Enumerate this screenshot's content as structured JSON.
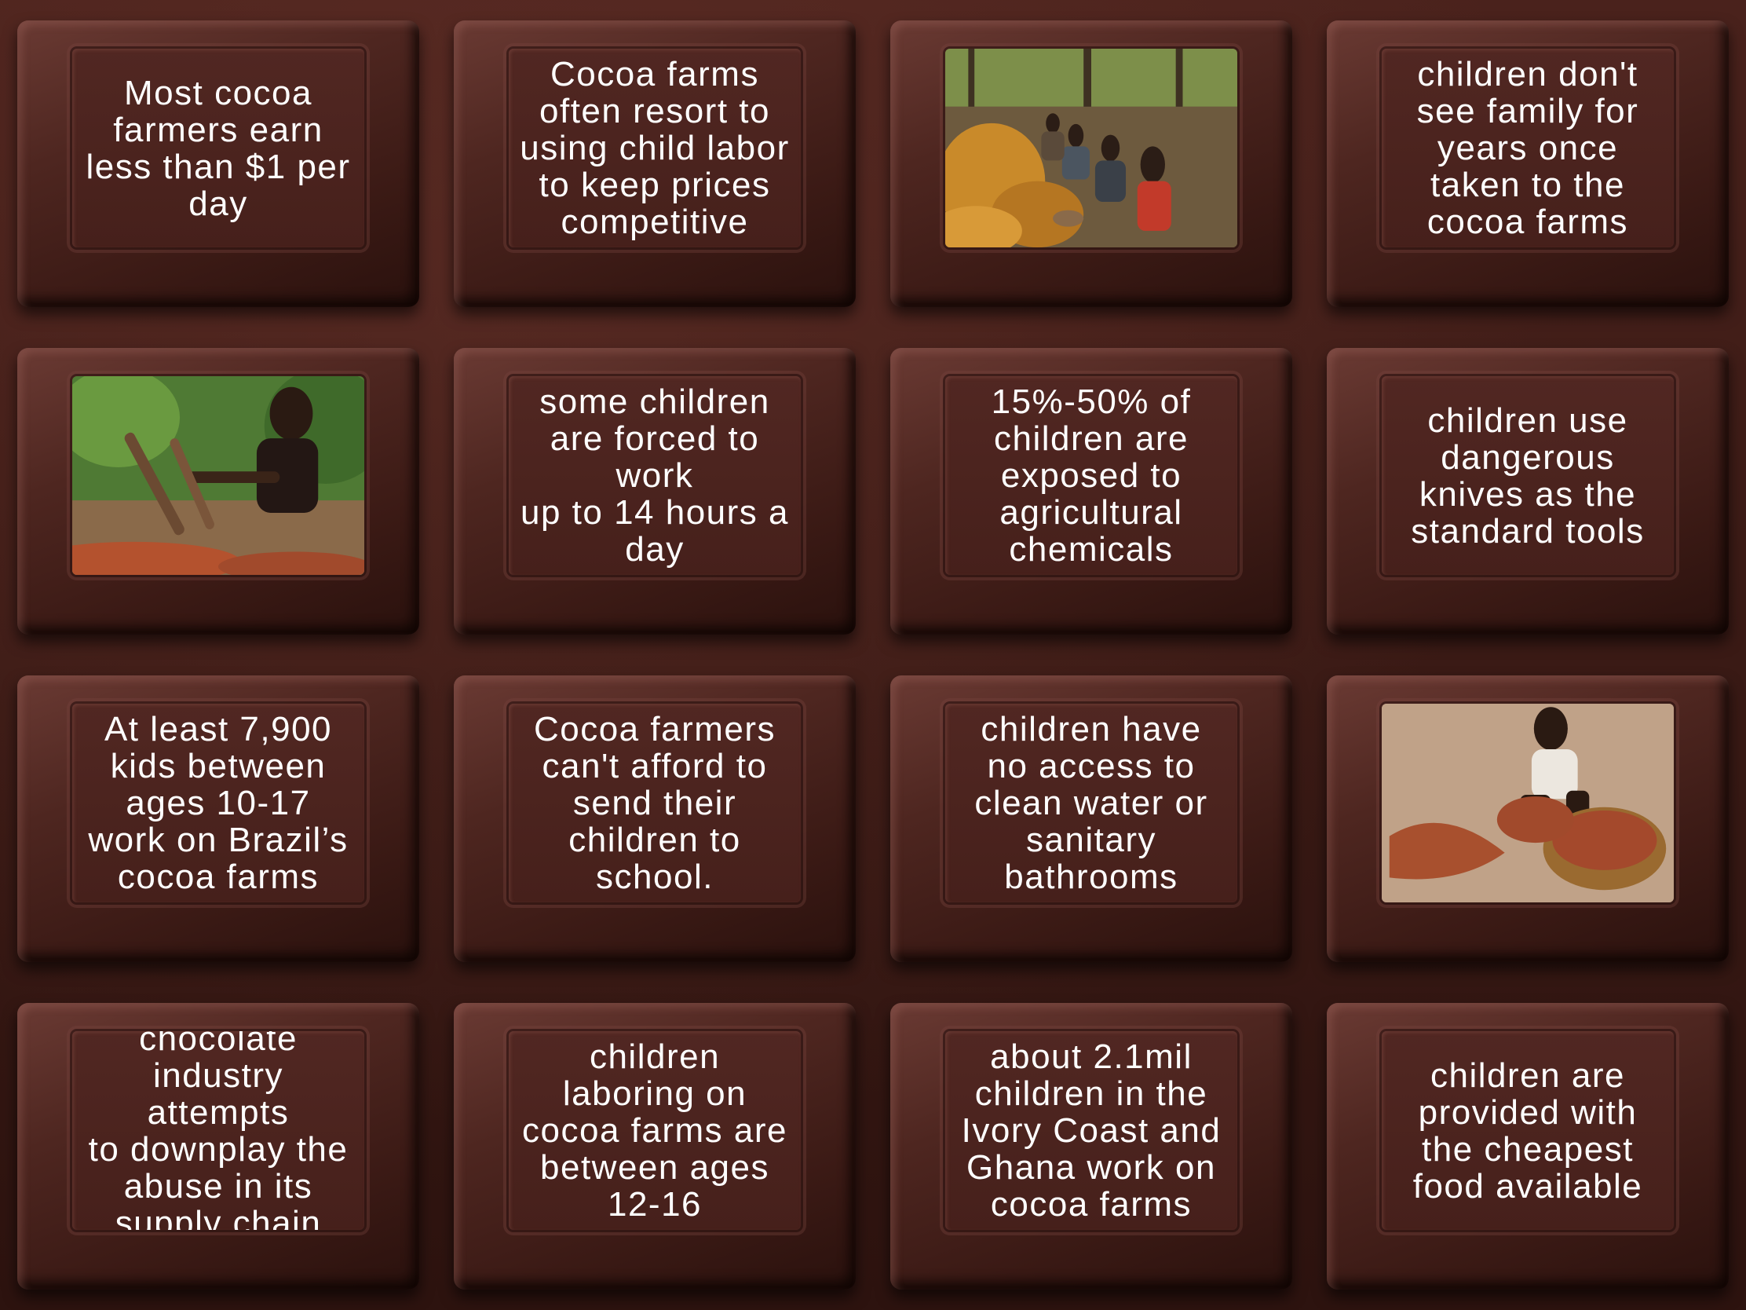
{
  "tiles": [
    {
      "text": "Most cocoa\nfarmers earn\nless than $1 per\nday"
    },
    {
      "text": "Cocoa farms\noften resort to\nusing child labor\nto keep prices\ncompetitive"
    },
    {
      "image": "children-sorting-cocoa-pods-photo"
    },
    {
      "text": "children don't\nsee family for\nyears once\ntaken to the\ncocoa farms"
    },
    {
      "image": "boy-with-machete-photo"
    },
    {
      "text": "some children\nare forced to\nwork\nup to 14 hours a\nday"
    },
    {
      "text": "15%-50% of\nchildren are\nexposed to\nagricultural\nchemicals"
    },
    {
      "text": "children use\ndangerous\nknives as the\nstandard tools"
    },
    {
      "text": "At least 7,900\nkids between\nages 10-17\nwork on Brazil’s\ncocoa farms"
    },
    {
      "text": "Cocoa farmers\ncan't afford to\nsend their\nchildren to\nschool."
    },
    {
      "text": "children have\nno access to\nclean water or\nsanitary\nbathrooms"
    },
    {
      "image": "child-with-cocoa-bean-basket-photo"
    },
    {
      "text": "chocolate\nindustry attempts\nto downplay the\nabuse in its\nsupply chain"
    },
    {
      "text": "children\nlaboring on\ncocoa farms are\nbetween ages\n12-16"
    },
    {
      "text": "about 2.1mil\nchildren in the\nIvory Coast and\nGhana work on\ncocoa farms"
    },
    {
      "text": "children are\nprovided with\nthe cheapest\nfood available"
    }
  ]
}
